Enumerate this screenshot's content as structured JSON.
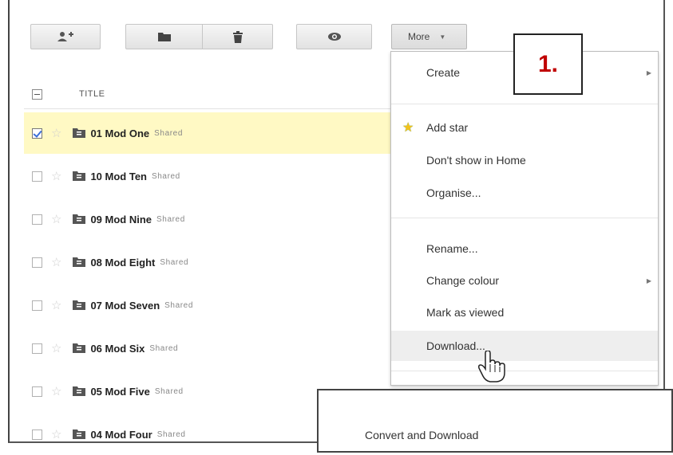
{
  "toolbar": {
    "buttons": [
      {
        "name": "add-people-icon"
      },
      {
        "name": "folder-icon"
      },
      {
        "name": "trash-icon"
      },
      {
        "name": "preview-eye-icon"
      }
    ],
    "more_label": "More",
    "more_caret": "▼"
  },
  "list": {
    "header_title": "TITLE",
    "rows": [
      {
        "name": "01 Mod One",
        "shared": "Shared",
        "selected": true
      },
      {
        "name": "10 Mod Ten",
        "shared": "Shared",
        "selected": false
      },
      {
        "name": "09 Mod Nine",
        "shared": "Shared",
        "selected": false
      },
      {
        "name": "08 Mod Eight",
        "shared": "Shared",
        "selected": false
      },
      {
        "name": "07 Mod Seven",
        "shared": "Shared",
        "selected": false
      },
      {
        "name": "06 Mod Six",
        "shared": "Shared",
        "selected": false
      },
      {
        "name": "05 Mod Five",
        "shared": "Shared",
        "selected": false
      },
      {
        "name": "04 Mod Four",
        "shared": "Shared",
        "selected": false
      }
    ]
  },
  "menu": {
    "create": "Create",
    "add_star": "Add star",
    "dont_show": "Don't show in Home",
    "organise": "Organise...",
    "rename": "Rename...",
    "change_colour": "Change colour",
    "mark_viewed": "Mark as viewed",
    "download": "Download...",
    "submenu_arrow": "▶"
  },
  "callout": {
    "step": "1."
  },
  "dialog": {
    "convert_download": "Convert and Download"
  },
  "colors": {
    "selected_row": "#fff9c4",
    "step_text": "#c00000",
    "star": "#f3c21b"
  }
}
